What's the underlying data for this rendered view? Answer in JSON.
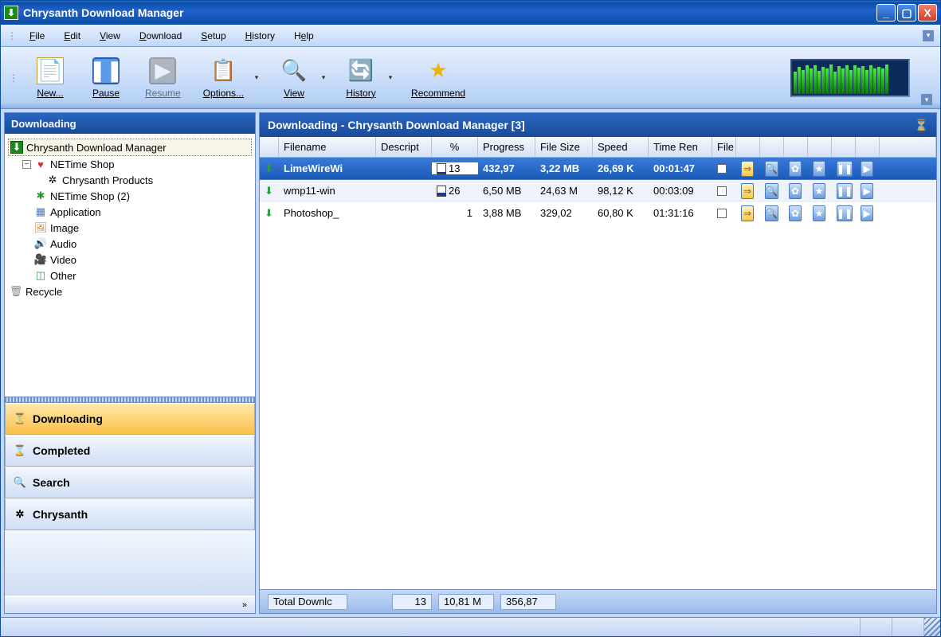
{
  "title": "Chrysanth Download Manager",
  "menu": {
    "file": "File",
    "edit": "Edit",
    "view": "View",
    "download": "Download",
    "setup": "Setup",
    "history": "History",
    "help": "Help"
  },
  "toolbar": {
    "new": "New...",
    "pause": "Pause",
    "resume": "Resume",
    "options": "Options...",
    "view": "View",
    "history": "History",
    "recommend": "Recommend"
  },
  "sidebar": {
    "header": "Downloading",
    "tree": {
      "root": "Chrysanth Download Manager",
      "netime": "NETime Shop",
      "products": "Chrysanth Products",
      "netime2": "NETime Shop (2)",
      "application": "Application",
      "image": "Image",
      "audio": "Audio",
      "video": "Video",
      "other": "Other",
      "recycle": "Recycle"
    },
    "nav": {
      "downloading": "Downloading",
      "completed": "Completed",
      "search": "Search",
      "chrysanth": "Chrysanth"
    }
  },
  "main": {
    "header": "Downloading - Chrysanth Download Manager [3]",
    "columns": {
      "filename": "Filename",
      "description": "Descript",
      "percent": "%",
      "progress": "Progress",
      "filesize": "File Size",
      "speed": "Speed",
      "timerem": "Time Ren",
      "file": "File"
    },
    "rows": [
      {
        "filename": "LimeWireWi",
        "percent": "13",
        "progress": "432,97",
        "filesize": "3,22 MB",
        "speed": "26,69 K",
        "timerem": "00:01:47"
      },
      {
        "filename": "wmp11-win",
        "percent": "26",
        "progress": "6,50 MB",
        "filesize": "24,63 M",
        "speed": "98,12 K",
        "timerem": "00:03:09"
      },
      {
        "filename": "Photoshop_",
        "percent": "1",
        "progress": "3,88 MB",
        "filesize": "329,02",
        "speed": "60,80 K",
        "timerem": "01:31:16"
      }
    ]
  },
  "footer": {
    "label": "Total Downlc",
    "percent": "13",
    "size": "10,81 M",
    "speed": "356,87"
  },
  "expand_label": "»"
}
